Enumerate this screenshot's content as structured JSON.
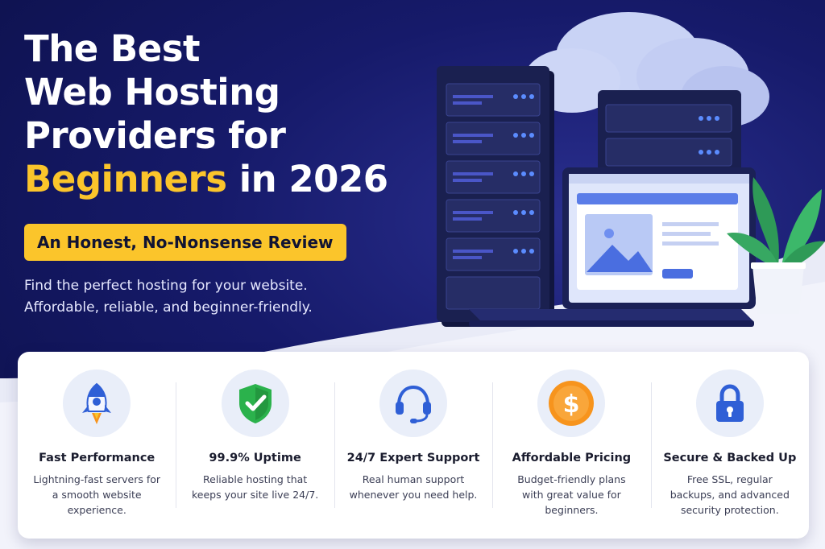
{
  "hero": {
    "title_lines": [
      "The Best",
      "Web Hosting",
      "Providers for"
    ],
    "title_accent": "Beginners",
    "title_tail": " in 2026",
    "subtitle": "An Honest, No-Nonsense Review",
    "tagline_lines": [
      "Find the perfect hosting for your website.",
      "Affordable, reliable, and beginner-friendly."
    ]
  },
  "colors": {
    "background": "#161a6a",
    "accent": "#fbc52b",
    "card": "#ffffff",
    "primary_icon": "#2f5fd6",
    "success": "#2bb24c",
    "pricing": "#f7941d"
  },
  "features": [
    {
      "icon": "rocket-icon",
      "title": "Fast Performance",
      "desc": "Lightning-fast servers for a smooth website experience."
    },
    {
      "icon": "shield-check-icon",
      "title": "99.9% Uptime",
      "desc": "Reliable hosting that keeps your site live 24/7."
    },
    {
      "icon": "headset-icon",
      "title": "24/7 Expert Support",
      "desc": "Real human support whenever you need help."
    },
    {
      "icon": "dollar-coin-icon",
      "title": "Affordable Pricing",
      "desc": "Budget-friendly plans with great value for beginners."
    },
    {
      "icon": "padlock-icon",
      "title": "Secure & Backed Up",
      "desc": "Free SSL, regular backups, and advanced security protection."
    }
  ]
}
